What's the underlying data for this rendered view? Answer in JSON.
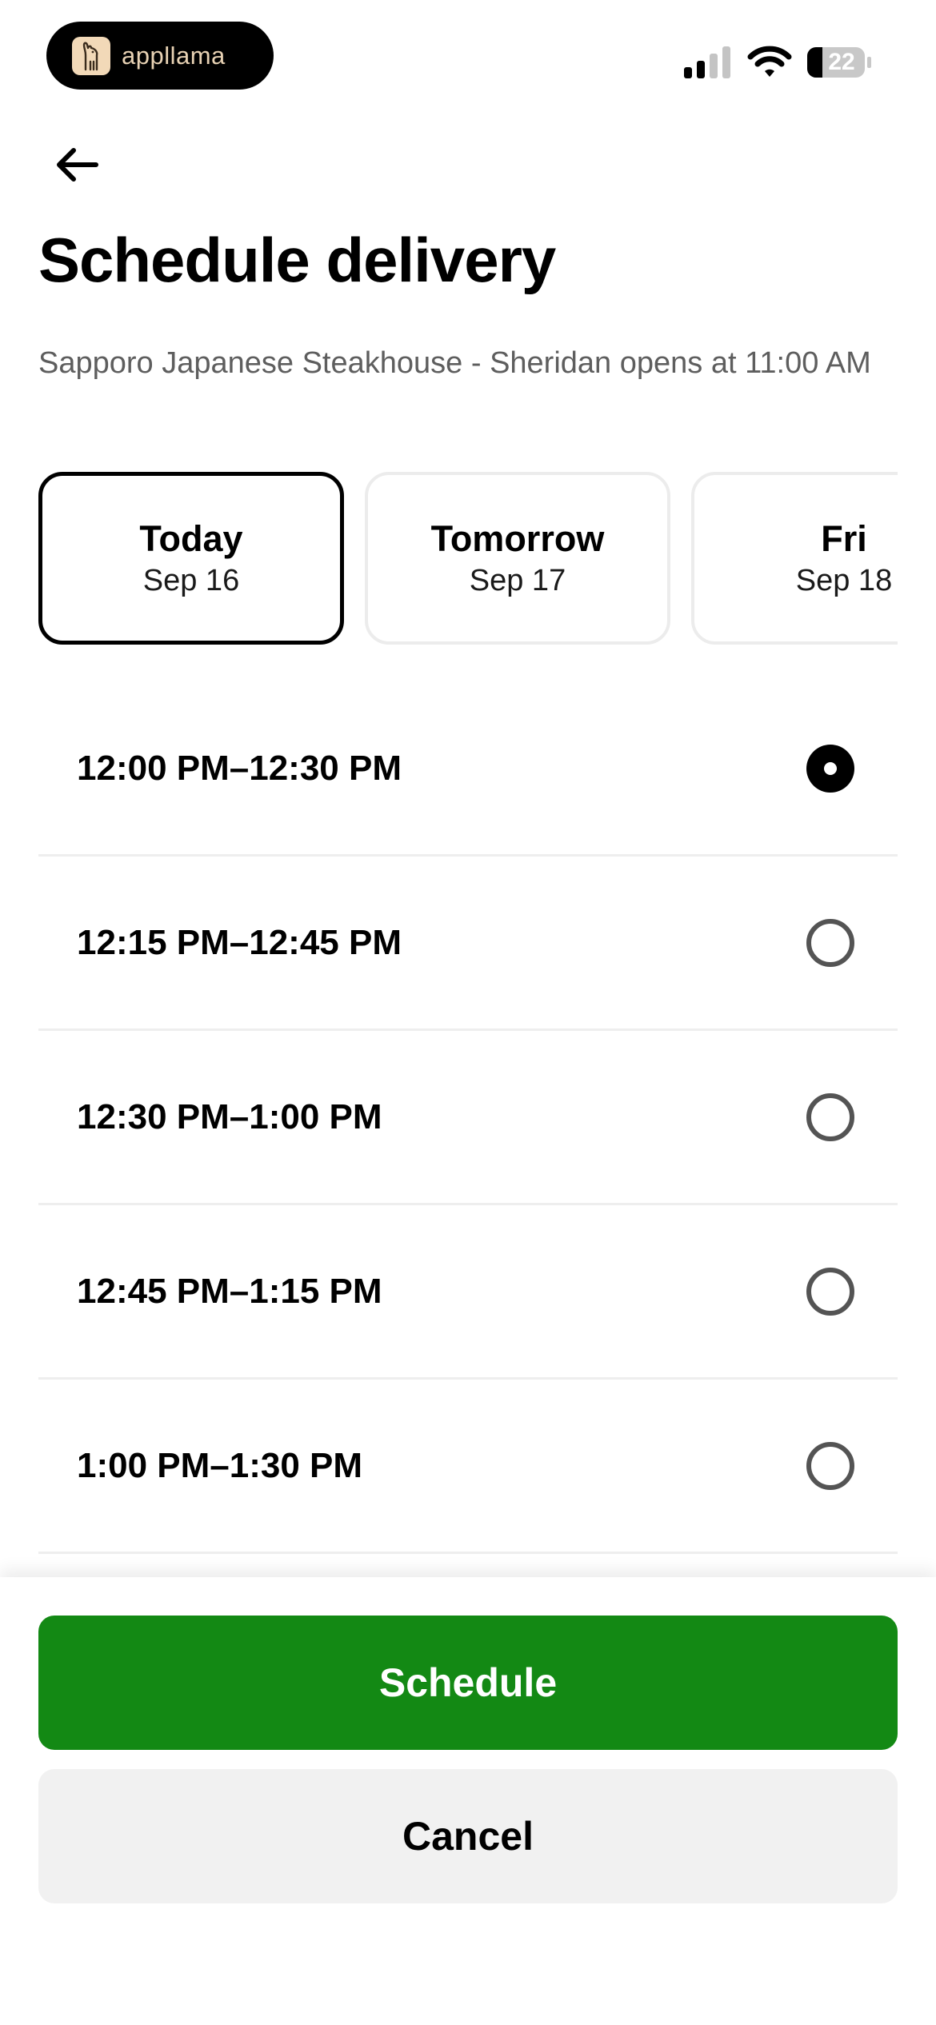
{
  "status_bar": {
    "app_name": "appllama",
    "battery_level": "22"
  },
  "header": {
    "back_icon": "arrow-left-icon",
    "title": "Schedule delivery",
    "subtitle": "Sapporo Japanese Steakhouse - Sheridan opens at 11:00 AM"
  },
  "dates": [
    {
      "day": "Today",
      "date": "Sep 16",
      "selected": true
    },
    {
      "day": "Tomorrow",
      "date": "Sep 17",
      "selected": false
    },
    {
      "day": "Fri",
      "date": "Sep 18",
      "selected": false
    }
  ],
  "time_slots": [
    {
      "label": "12:00 PM–12:30 PM",
      "selected": true
    },
    {
      "label": "12:15 PM–12:45 PM",
      "selected": false
    },
    {
      "label": "12:30 PM–1:00 PM",
      "selected": false
    },
    {
      "label": "12:45 PM–1:15 PM",
      "selected": false
    },
    {
      "label": "1:00 PM–1:30 PM",
      "selected": false
    }
  ],
  "actions": {
    "schedule_label": "Schedule",
    "cancel_label": "Cancel"
  },
  "colors": {
    "primary": "#138914",
    "secondary_bg": "#f1f1f1",
    "text": "#000000",
    "muted_text": "#5e5e5e"
  }
}
